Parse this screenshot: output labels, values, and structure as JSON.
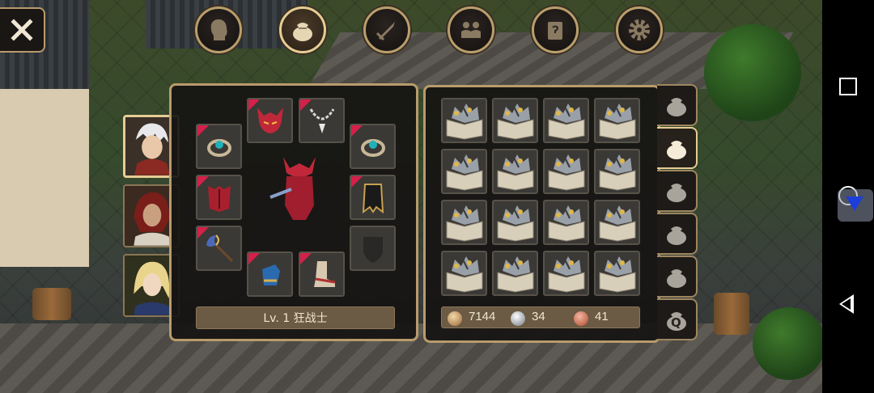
{
  "top_menu": [
    {
      "id": "character",
      "icon": "head-silhouette-icon",
      "active": false
    },
    {
      "id": "inventory",
      "icon": "bag-icon",
      "active": true
    },
    {
      "id": "skills",
      "icon": "sword-icon",
      "active": false
    },
    {
      "id": "party",
      "icon": "people-icon",
      "active": false
    },
    {
      "id": "quests",
      "icon": "scroll-icon",
      "active": false
    },
    {
      "id": "settings",
      "icon": "gear-icon",
      "active": false
    }
  ],
  "characters": [
    {
      "id": "berserker",
      "selected": true
    },
    {
      "id": "red-haired",
      "selected": false
    },
    {
      "id": "blonde-elf",
      "selected": false
    }
  ],
  "equipment": {
    "level_label": "Lv. 1 狂战士",
    "slots": [
      {
        "id": "helmet",
        "icon": "demon-helmet-icon",
        "rare": true
      },
      {
        "id": "necklace",
        "icon": "necklace-icon",
        "rare": true
      },
      {
        "id": "ring-left",
        "icon": "ring-icon",
        "rare": true
      },
      {
        "id": "ring-right",
        "icon": "ring-icon",
        "rare": true
      },
      {
        "id": "armor",
        "icon": "armor-icon",
        "rare": true
      },
      {
        "id": "cape",
        "icon": "cape-icon",
        "rare": true
      },
      {
        "id": "weapon",
        "icon": "battle-axe-icon",
        "rare": true
      },
      {
        "id": "offhand",
        "icon": "shield-placeholder-icon",
        "rare": false
      },
      {
        "id": "gloves",
        "icon": "gauntlet-icon",
        "rare": true
      },
      {
        "id": "boots",
        "icon": "boot-icon",
        "rare": true
      }
    ]
  },
  "inventory": {
    "rows": 4,
    "cols": 4,
    "item_icon": "treasure-crate-icon"
  },
  "currency": {
    "gold": "7144",
    "silver": "34",
    "copper": "41"
  },
  "bag_tabs": [
    {
      "id": "bag-1",
      "active": false,
      "label": ""
    },
    {
      "id": "bag-2",
      "active": true,
      "label": ""
    },
    {
      "id": "bag-3",
      "active": false,
      "label": ""
    },
    {
      "id": "bag-4",
      "active": false,
      "label": ""
    },
    {
      "id": "bag-5",
      "active": false,
      "label": ""
    },
    {
      "id": "bag-quest",
      "active": false,
      "label": "Q"
    }
  ],
  "colors": {
    "border_gold": "#b89b6c",
    "rare_marker": "#d4204a",
    "panel_bg": "#161412"
  }
}
